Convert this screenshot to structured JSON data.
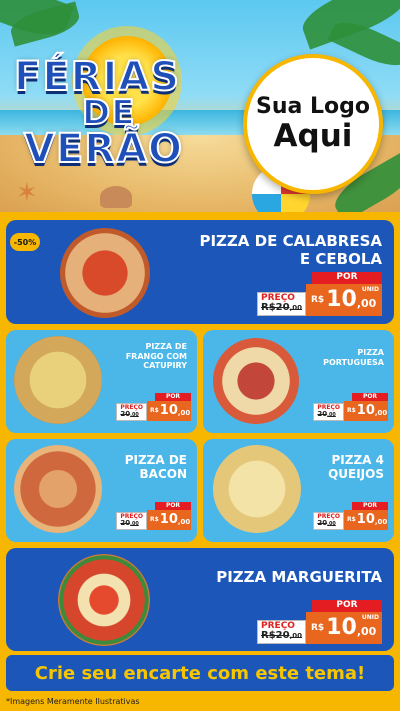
{
  "header": {
    "title_line1": "FÉRIAS",
    "title_line2": "DE",
    "title_line3": "VERÃO",
    "logo_line1": "Sua Logo",
    "logo_line2": "Aqui"
  },
  "featured": [
    {
      "discount_badge": "-50%",
      "name_line1": "PIZZA DE CALABRESA",
      "name_line2": "E CEBOLA",
      "old_label": "PREÇO",
      "old_price_int": "R$20",
      "old_price_dec": ",00",
      "new_label": "POR",
      "currency": "R$",
      "new_price_int": "10",
      "new_price_dec": ",00",
      "unit": "UNID"
    },
    {
      "name": "PIZZA MARGUERITA",
      "old_label": "PREÇO",
      "old_price_int": "R$20",
      "old_price_dec": ",00",
      "new_label": "POR",
      "currency": "R$",
      "new_price_int": "10",
      "new_price_dec": ",00",
      "unit": "UNID"
    }
  ],
  "grid": [
    {
      "name_line1": "PIZZA DE",
      "name_line2": "FRANGO COM",
      "name_line3": "CATUPIRY",
      "old_label": "PREÇO",
      "old_price_int": "20",
      "old_price_dec": ",00",
      "new_label": "POR",
      "currency": "R$",
      "new_price_int": "10",
      "new_price_dec": ",00"
    },
    {
      "name_line1": "PIZZA",
      "name_line2": "PORTUGUESA",
      "old_label": "PREÇO",
      "old_price_int": "20",
      "old_price_dec": ",00",
      "new_label": "POR",
      "currency": "R$",
      "new_price_int": "10",
      "new_price_dec": ",00"
    },
    {
      "name_line1": "PIZZA DE",
      "name_line2": "BACON",
      "old_label": "PREÇO",
      "old_price_int": "20",
      "old_price_dec": ",00",
      "new_label": "POR",
      "currency": "R$",
      "new_price_int": "10",
      "new_price_dec": ",00"
    },
    {
      "name_line1": "PIZZA 4",
      "name_line2": "QUEIJOS",
      "old_label": "PREÇO",
      "old_price_int": "20",
      "old_price_dec": ",00",
      "new_label": "POR",
      "currency": "R$",
      "new_price_int": "10",
      "new_price_dec": ",00"
    }
  ],
  "footer": {
    "cta": "Crie seu encarte com este tema!",
    "disclaimer": "*Imagens Meramente Ilustrativas"
  },
  "colors": {
    "background": "#f7b600",
    "card_dark": "#1b56b8",
    "card_light": "#4bb7e8",
    "price_red": "#e41d22",
    "price_orange": "#e8661e",
    "cta_text": "#f7c600"
  }
}
